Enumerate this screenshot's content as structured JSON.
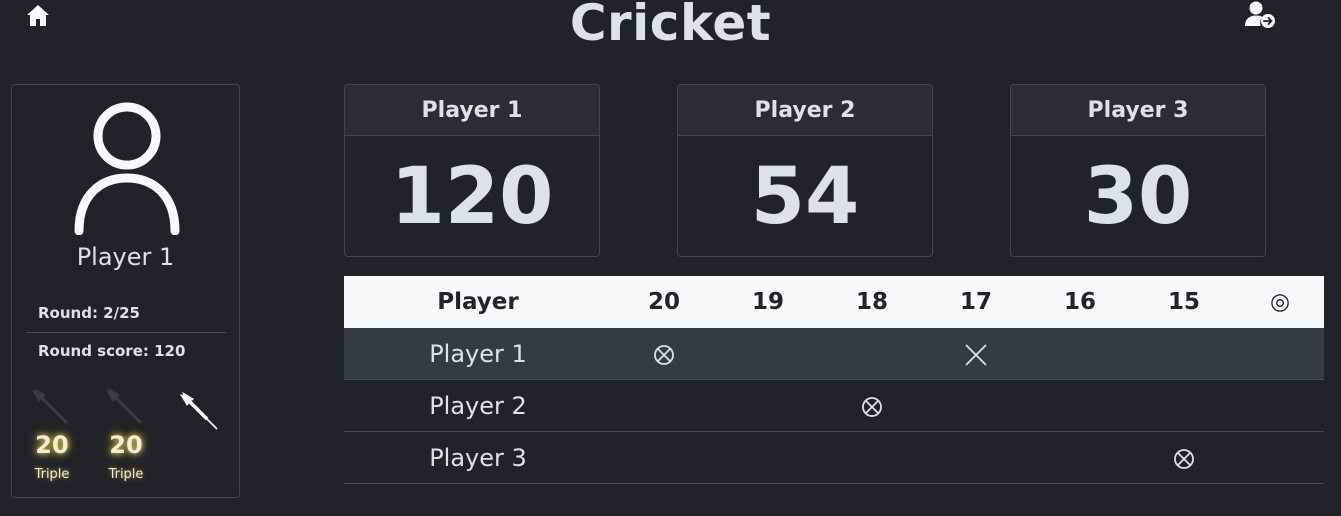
{
  "header": {
    "title": "Cricket",
    "home_icon": "home-icon",
    "switch_user_icon": "user-switch-icon"
  },
  "current_player": {
    "name": "Player 1",
    "round_label": "Round: 2/25",
    "round_score_label": "Round score: 120",
    "darts": [
      {
        "score": "20",
        "multiplier": "Triple",
        "thrown": true
      },
      {
        "score": "20",
        "multiplier": "Triple",
        "thrown": true
      },
      {
        "score": "",
        "multiplier": "",
        "thrown": false
      }
    ]
  },
  "score_cards": [
    {
      "name": "Player 1",
      "score": "120"
    },
    {
      "name": "Player 2",
      "score": "54"
    },
    {
      "name": "Player 3",
      "score": "30"
    }
  ],
  "table": {
    "headers": [
      "Player",
      "20",
      "19",
      "18",
      "17",
      "16",
      "15",
      "◎"
    ],
    "rows": [
      {
        "player": "Player 1",
        "active": true,
        "marks": [
          3,
          0,
          0,
          2,
          0,
          0,
          0
        ]
      },
      {
        "player": "Player 2",
        "active": false,
        "marks": [
          0,
          0,
          3,
          0,
          0,
          0,
          0
        ]
      },
      {
        "player": "Player 3",
        "active": false,
        "marks": [
          0,
          0,
          0,
          0,
          0,
          3,
          0
        ]
      }
    ]
  },
  "colors": {
    "background": "#212327",
    "text": "#dee2e6",
    "table_header_bg": "#f8f9fa",
    "active_row_bg": "#373a3e",
    "dart_score_glow": "#d4c25a"
  }
}
